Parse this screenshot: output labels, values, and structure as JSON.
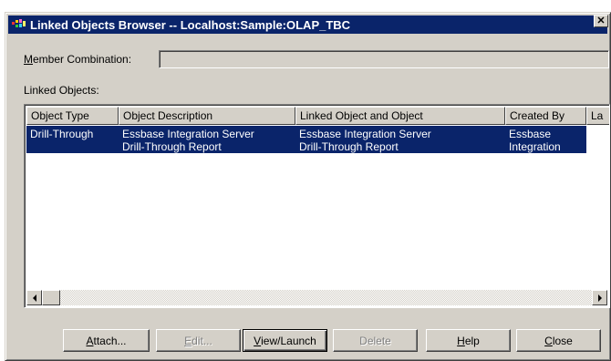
{
  "window": {
    "title": "Linked Objects Browser  -- Localhost:Sample:OLAP_TBC",
    "close_glyph": "✕"
  },
  "member_combination": {
    "label_first": "M",
    "label_rest": "ember Combination:",
    "value": ""
  },
  "linked_objects": {
    "label": "Linked Objects:",
    "columns": [
      "Object Type",
      "Object Description",
      "Linked Object and Object",
      "Created By",
      "La"
    ],
    "rows": [
      {
        "object_type": "Drill-Through",
        "object_description": "Essbase Integration Server",
        "object_description_line2": "Drill-Through Report",
        "linked_object": "Essbase Integration Server",
        "linked_object_line2": "Drill-Through Report",
        "created_by": "Essbase",
        "created_by_line2": "Integration",
        "last": ""
      }
    ]
  },
  "buttons": {
    "attach": {
      "first": "A",
      "rest": "ttach..."
    },
    "edit": {
      "first": "E",
      "rest": "dit..."
    },
    "view_launch": {
      "first": "V",
      "rest": "iew/Launch"
    },
    "delete": {
      "label": "Delete"
    },
    "help": {
      "first": "H",
      "rest": "elp"
    },
    "close": {
      "first": "C",
      "rest": "lose"
    }
  },
  "icons": {
    "app": "app-icon",
    "close": "close-icon",
    "scroll_left": "scroll-left-arrow-icon",
    "scroll_right": "scroll-right-arrow-icon"
  },
  "colors": {
    "title_bar": "#0a246a",
    "dialog_face": "#d4d0c8",
    "selection": "#0a246a"
  }
}
